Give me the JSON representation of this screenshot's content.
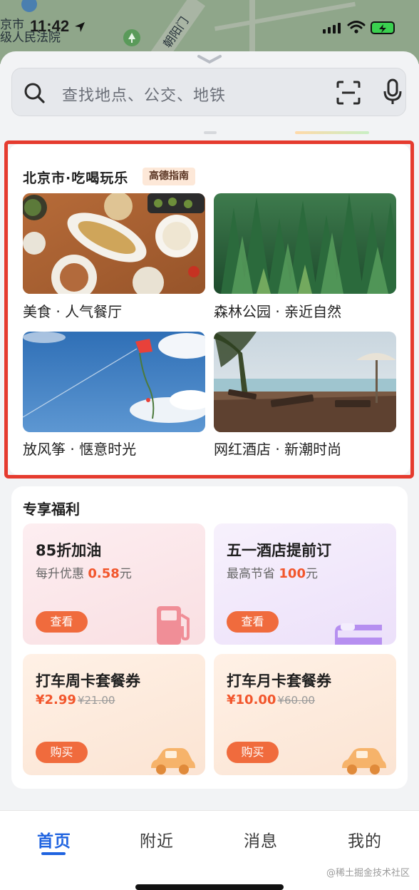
{
  "status_bar": {
    "time": "11:42"
  },
  "map": {
    "label_court": "京市\n级人民法院",
    "label_road": "朝阳门"
  },
  "search": {
    "placeholder": "查找地点、公交、地铁"
  },
  "section_play": {
    "title": "北京市·吃喝玩乐",
    "badge": "高德指南",
    "tiles": [
      {
        "caption": "美食 · 人气餐厅"
      },
      {
        "caption": "森林公园 · 亲近自然"
      },
      {
        "caption": "放风筝 · 惬意时光"
      },
      {
        "caption": "网红酒店 · 新潮时尚"
      }
    ]
  },
  "section_benefits": {
    "title": "专享福利",
    "cards": [
      {
        "title": "85折加油",
        "sub_prefix": "每升优惠",
        "sub_value": "0.58",
        "sub_suffix": "元",
        "button": "查看"
      },
      {
        "title": "五一酒店提前订",
        "sub_prefix": "最高节省",
        "sub_value": "100",
        "sub_suffix": "元",
        "button": "查看"
      },
      {
        "title": "打车周卡套餐券",
        "price": "¥2.99",
        "old_price": "¥21.00",
        "button": "购买"
      },
      {
        "title": "打车月卡套餐券",
        "price": "¥10.00",
        "old_price": "¥60.00",
        "button": "购买"
      }
    ]
  },
  "tabs": [
    {
      "label": "首页",
      "active": true
    },
    {
      "label": "附近"
    },
    {
      "label": "消息"
    },
    {
      "label": "我的"
    }
  ],
  "watermark": "@稀土掘金技术社区",
  "colors": {
    "accent_blue": "#1f63e0",
    "highlight_red": "#e53b2f",
    "button_orange": "#f06b3d",
    "price_orange": "#f2562c"
  }
}
